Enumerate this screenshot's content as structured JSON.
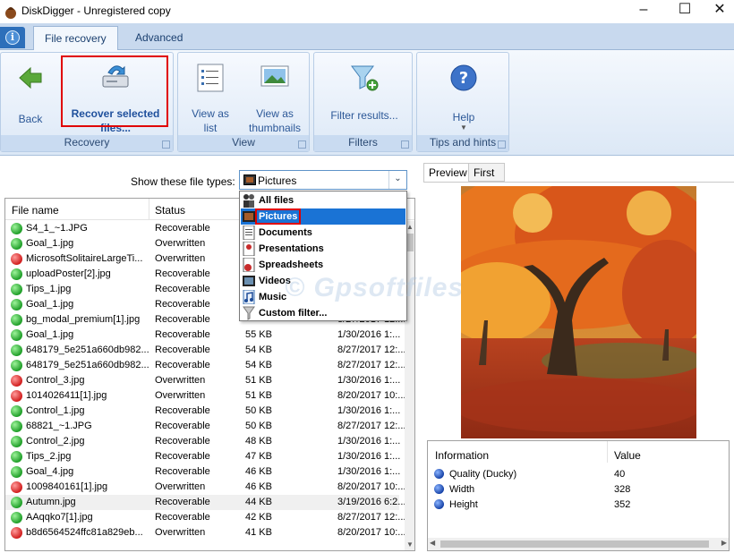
{
  "window": {
    "title": "DiskDigger - Unregistered copy",
    "controls": [
      "–",
      "☐",
      "✕"
    ]
  },
  "ribbon": {
    "tabs": [
      "File recovery",
      "Advanced"
    ],
    "groups": {
      "recovery": {
        "label": "Recovery",
        "back": "Back",
        "recover": "Recover selected files..."
      },
      "view": {
        "label": "View",
        "list": "View as list",
        "thumbs": "View as thumbnails"
      },
      "filters": {
        "label": "Filters",
        "filter": "Filter results..."
      },
      "help": {
        "label": "Tips and hints",
        "help": "Help"
      }
    }
  },
  "filter": {
    "label": "Show these file types:",
    "selected": "Pictures",
    "options": [
      "All files",
      "Pictures",
      "Documents",
      "Presentations",
      "Spreadsheets",
      "Videos",
      "Music",
      "Custom filter..."
    ]
  },
  "file_list": {
    "columns": [
      "File name",
      "Status"
    ],
    "rows": [
      {
        "status_color": "green",
        "name": "S4_1_~1.JPG",
        "status": "Recoverable",
        "size": "",
        "date": ""
      },
      {
        "status_color": "green",
        "name": "Goal_1.jpg",
        "status": "Overwritten",
        "size": "",
        "date": ""
      },
      {
        "status_color": "red",
        "name": "MicrosoftSolitaireLargeTi...",
        "status": "Overwritten",
        "size": "",
        "date": ""
      },
      {
        "status_color": "green",
        "name": "uploadPoster[2].jpg",
        "status": "Recoverable",
        "size": "",
        "date": ""
      },
      {
        "status_color": "green",
        "name": "Tips_1.jpg",
        "status": "Recoverable",
        "size": "",
        "date": ""
      },
      {
        "status_color": "green",
        "name": "Goal_1.jpg",
        "status": "Recoverable",
        "size": "",
        "date": ""
      },
      {
        "status_color": "green",
        "name": "bg_modal_premium[1].jpg",
        "status": "Recoverable",
        "size": "",
        "date": "8/27/2017 12:..."
      },
      {
        "status_color": "green",
        "name": "Goal_1.jpg",
        "status": "Recoverable",
        "size": "55 KB",
        "date": "1/30/2016 1:..."
      },
      {
        "status_color": "green",
        "name": "648179_5e251a660db982...",
        "status": "Recoverable",
        "size": "54 KB",
        "date": "8/27/2017 12:..."
      },
      {
        "status_color": "green",
        "name": "648179_5e251a660db982...",
        "status": "Recoverable",
        "size": "54 KB",
        "date": "8/27/2017 12:..."
      },
      {
        "status_color": "red",
        "name": "Control_3.jpg",
        "status": "Overwritten",
        "size": "51 KB",
        "date": "1/30/2016 1:..."
      },
      {
        "status_color": "red",
        "name": "1014026411[1].jpg",
        "status": "Overwritten",
        "size": "51 KB",
        "date": "8/20/2017 10:..."
      },
      {
        "status_color": "green",
        "name": "Control_1.jpg",
        "status": "Recoverable",
        "size": "50 KB",
        "date": "1/30/2016 1:..."
      },
      {
        "status_color": "green",
        "name": "68821_~1.JPG",
        "status": "Recoverable",
        "size": "50 KB",
        "date": "8/27/2017 12:..."
      },
      {
        "status_color": "green",
        "name": "Control_2.jpg",
        "status": "Recoverable",
        "size": "48 KB",
        "date": "1/30/2016 1:..."
      },
      {
        "status_color": "green",
        "name": "Tips_2.jpg",
        "status": "Recoverable",
        "size": "47 KB",
        "date": "1/30/2016 1:..."
      },
      {
        "status_color": "green",
        "name": "Goal_4.jpg",
        "status": "Recoverable",
        "size": "46 KB",
        "date": "1/30/2016 1:..."
      },
      {
        "status_color": "red",
        "name": "1009840161[1].jpg",
        "status": "Overwritten",
        "size": "46 KB",
        "date": "8/20/2017 10:..."
      },
      {
        "status_color": "green",
        "name": "Autumn.jpg",
        "status": "Recoverable",
        "size": "44 KB",
        "date": "3/19/2016 6:2..."
      },
      {
        "status_color": "green",
        "name": "AAqqko7[1].jpg",
        "status": "Recoverable",
        "size": "42 KB",
        "date": "8/27/2017 12:..."
      },
      {
        "status_color": "red",
        "name": "b8d6564524ffc81a829eb...",
        "status": "Overwritten",
        "size": "41 KB",
        "date": "8/20/2017 10:..."
      }
    ]
  },
  "preview": {
    "tabs": [
      "Preview",
      "First few bytes"
    ]
  },
  "info": {
    "columns": [
      "Information",
      "Value"
    ],
    "rows": [
      {
        "key": "Quality (Ducky)",
        "value": "40"
      },
      {
        "key": "Width",
        "value": "328"
      },
      {
        "key": "Height",
        "value": "352"
      }
    ]
  },
  "watermark": "©  Gpsoftfiles"
}
